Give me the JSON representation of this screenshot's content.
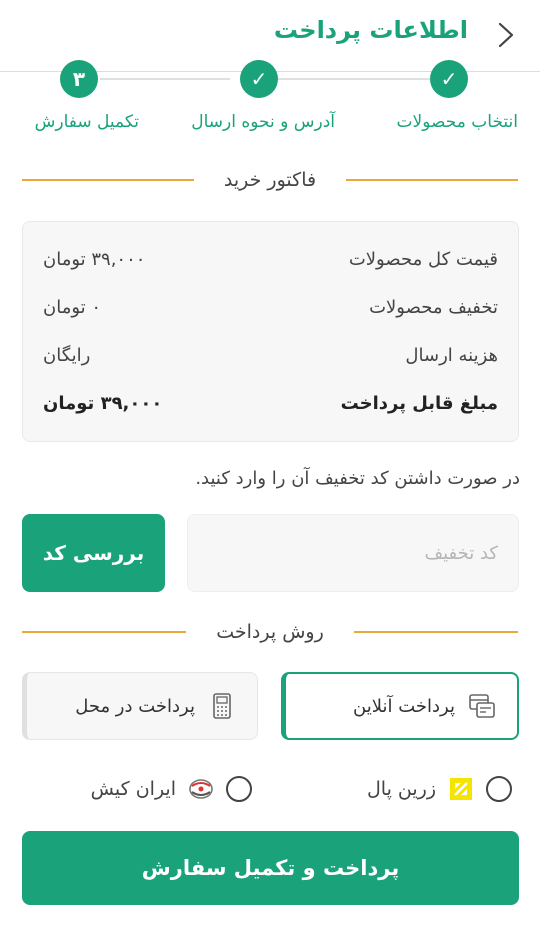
{
  "header": {
    "title": "اطلاعات پرداخت",
    "back_icon": "chevron-right-icon"
  },
  "stepper": {
    "steps": [
      {
        "label": "انتخاب محصولات",
        "mark": "✓"
      },
      {
        "label": "آدرس و نحوه ارسال",
        "mark": "✓"
      },
      {
        "label": "تکمیل سفارش",
        "mark": "۳"
      }
    ]
  },
  "invoice": {
    "heading": "فاکتور خرید",
    "rows": [
      {
        "label": "قیمت کل محصولات",
        "value": "۳۹,۰۰۰ تومان"
      },
      {
        "label": "تخفیف محصولات",
        "value": "۰ تومان"
      },
      {
        "label": "هزینه ارسال",
        "value": "رایگان"
      },
      {
        "label": "مبلغ قابل پرداخت",
        "value": "۳۹,۰۰۰ تومان"
      }
    ]
  },
  "discount": {
    "hint": "در صورت داشتن کد تخفیف آن را وارد کنید.",
    "placeholder": "کد تخفیف",
    "button": "بررسی کد"
  },
  "payment": {
    "heading": "روش پرداخت",
    "online": "پرداخت آنلاین",
    "on_site": "پرداخت در محل",
    "gateways": [
      {
        "label": "زرین پال"
      },
      {
        "label": "ایران کیش"
      }
    ]
  },
  "submit": {
    "label": "پرداخت و تکمیل سفارش"
  },
  "colors": {
    "accent": "#1aa37a",
    "divider": "#e8a93a"
  }
}
